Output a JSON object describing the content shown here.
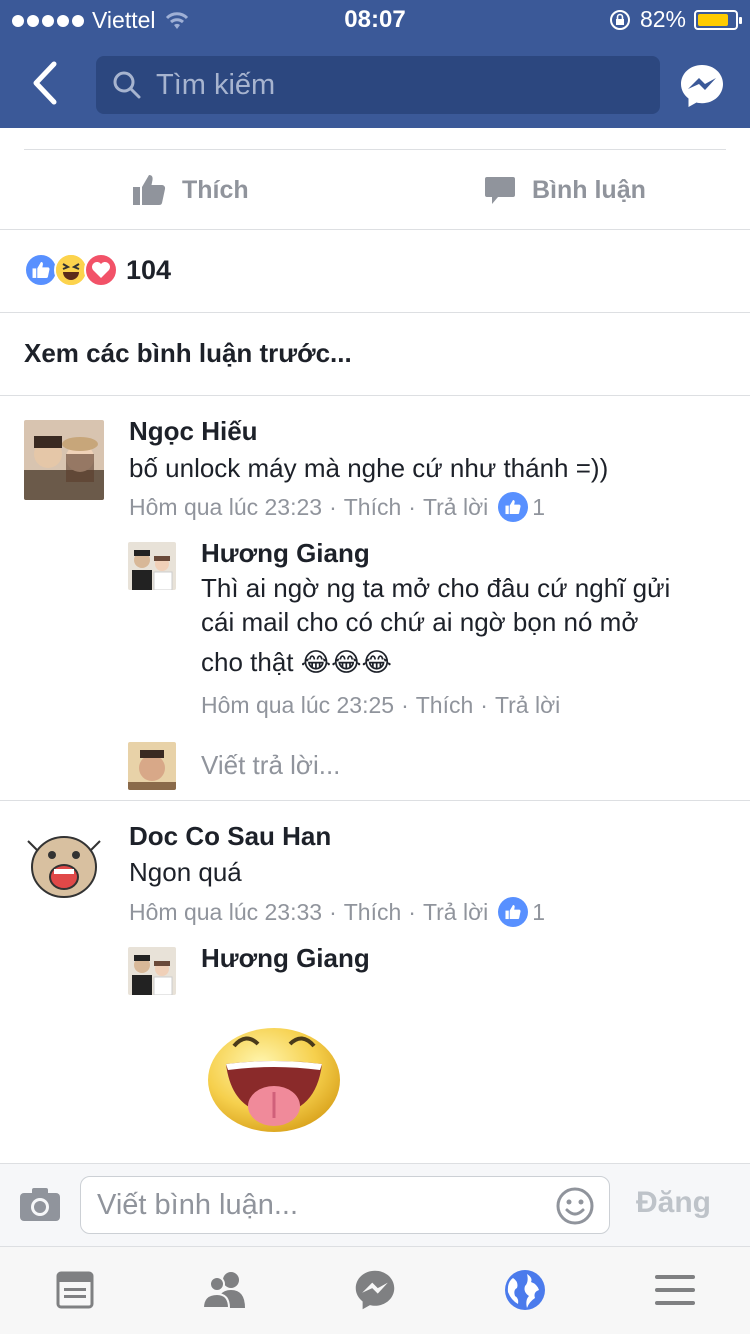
{
  "status_bar": {
    "carrier": "Viettel",
    "time": "08:07",
    "battery_percent": "82%",
    "battery_level": 0.82,
    "battery_color": "#ffcc00"
  },
  "nav": {
    "search_placeholder": "Tìm kiếm",
    "brand_color": "#3b5998"
  },
  "post_actions": {
    "like_label": "Thích",
    "comment_label": "Bình luận"
  },
  "reactions": {
    "types": [
      "like",
      "haha",
      "love"
    ],
    "count": "104"
  },
  "view_previous": "Xem các bình luận trước...",
  "comments": [
    {
      "name": "Ngọc Hiếu",
      "text": "bố unlock máy mà nghe cứ như thánh =))",
      "time": "Hôm qua lúc 23:23",
      "like": "Thích",
      "reply": "Trả lời",
      "likes": "1",
      "replies": [
        {
          "name": "Hương Giang",
          "text_line1": "Thì ai ngờ ng ta mở cho đâu cứ nghĩ gửi",
          "text_line2": "cái mail cho có chứ ai ngờ bọn nó mở",
          "text_line3": "cho thật 😂😂😂",
          "time": "Hôm qua lúc 23:25",
          "like": "Thích",
          "reply": "Trả lời"
        }
      ],
      "write_reply": "Viết trả lời..."
    },
    {
      "name": "Doc Co Sau Han",
      "text": "Ngon quá",
      "time": "Hôm qua lúc 23:33",
      "like": "Thích",
      "reply": "Trả lời",
      "likes": "1",
      "replies": [
        {
          "name": "Hương Giang",
          "sticker": "tongue-out-sticker"
        }
      ]
    }
  ],
  "composer": {
    "placeholder": "Viết bình luận...",
    "post_label": "Đăng"
  },
  "tabs": [
    "news-feed-icon",
    "friends-icon",
    "messenger-icon",
    "globe-icon",
    "menu-icon"
  ],
  "accent_color": "#5890ff"
}
